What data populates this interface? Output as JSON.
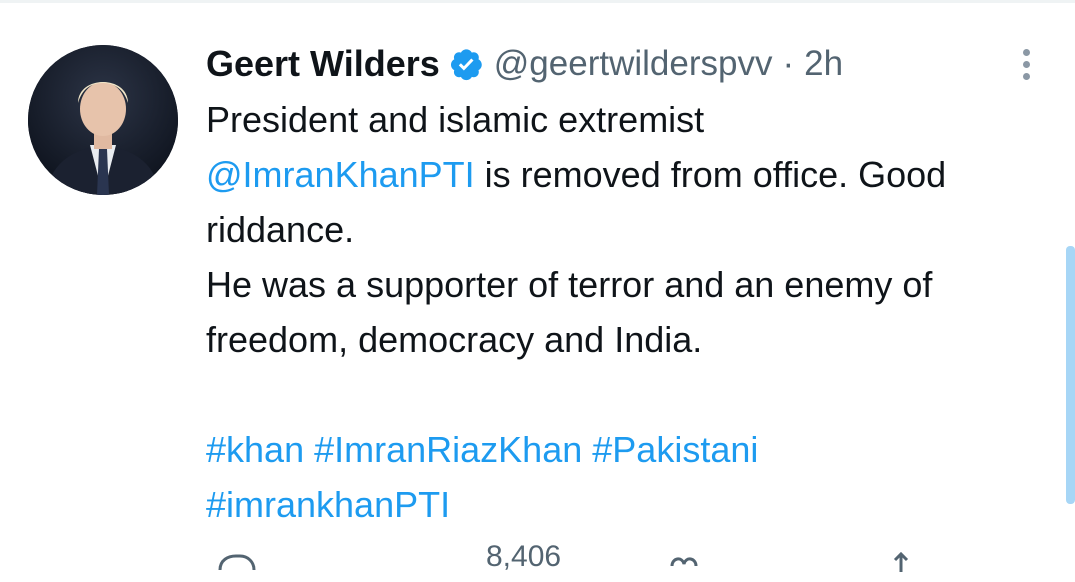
{
  "tweet": {
    "author_name": "Geert Wilders",
    "handle": "@geertwilderspvv",
    "separator": "·",
    "time": "2h",
    "text_line1": "President and islamic extremist",
    "mention": "@ImranKhanPTI",
    "text_line2_rest": " is removed from office. Good",
    "text_line3": "riddance.",
    "text_line4": "He was a supporter of terror and an enemy of",
    "text_line5": "freedom, democracy and India.",
    "hashtags_line1": [
      "#khan",
      "#ImranRiazKhan",
      "#Pakistani"
    ],
    "hashtags_line2": "#imrankhanPTI",
    "reply_count": "8,406"
  },
  "icons": {
    "verified": "verified-badge-icon",
    "more": "more-options-icon",
    "reply": "reply-icon",
    "like": "like-icon",
    "share": "share-icon"
  },
  "colors": {
    "link": "#1d9bf0",
    "text": "#0f1419",
    "secondary": "#536471"
  }
}
